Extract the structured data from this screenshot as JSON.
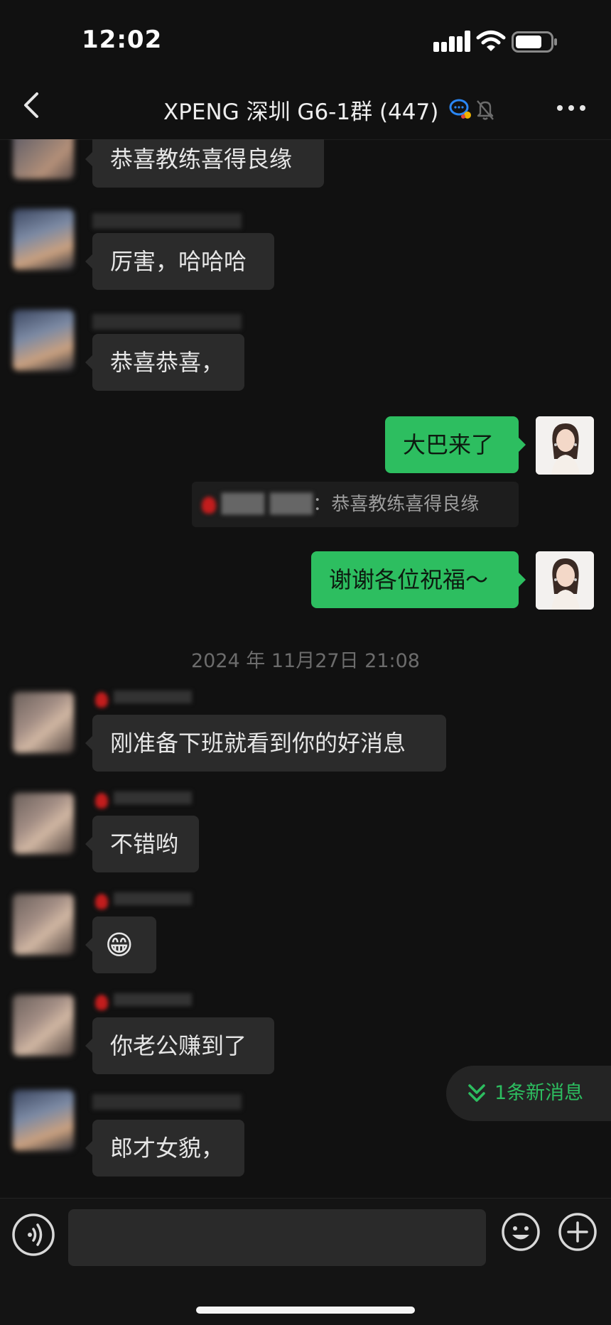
{
  "status_bar": {
    "time": "12:02"
  },
  "header": {
    "title": "XPENG 深圳 G6-1群 (447)"
  },
  "messages": [
    {
      "side": "left",
      "text": "恭喜教练喜得良缘"
    },
    {
      "side": "left",
      "text": "厉害，哈哈哈"
    },
    {
      "side": "left",
      "text": "恭喜恭喜，"
    },
    {
      "side": "right",
      "text": "大巴来了"
    },
    {
      "side": "quote",
      "text": "：恭喜教练喜得良缘"
    },
    {
      "side": "right",
      "text": "谢谢各位祝福～"
    },
    {
      "side": "timestamp",
      "text": "2024 年 11月27日  21:08"
    },
    {
      "side": "left",
      "text": "刚准备下班就看到你的好消息"
    },
    {
      "side": "left",
      "text": "不错哟"
    },
    {
      "side": "left",
      "text": "😁"
    },
    {
      "side": "left",
      "text": "你老公赚到了"
    },
    {
      "side": "left",
      "text": "郎才女貌，"
    }
  ],
  "new_messages": {
    "label": "1条新消息"
  },
  "colors": {
    "accent": "#2dbe60",
    "background": "#111111",
    "bubble_left": "#2b2b2b"
  },
  "icons": [
    "back-icon",
    "group-chat-icon",
    "mute-bell-icon",
    "more-icon",
    "voice-icon",
    "emoji-icon",
    "plus-icon",
    "double-chevron-down-icon"
  ]
}
